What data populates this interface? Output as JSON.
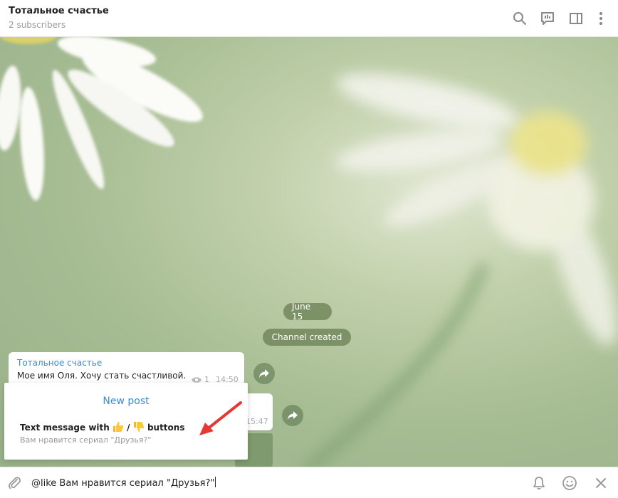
{
  "header": {
    "title": "Тотальное счастье",
    "subtitle": "2 subscribers",
    "icons": [
      "search-icon",
      "discuss-icon",
      "sidebar-toggle-icon",
      "more-vertical-icon"
    ]
  },
  "chat": {
    "date_pill": "June 15",
    "service_pill": "Channel created",
    "messages": [
      {
        "sender": "Тотальное счастье",
        "text": "Мое имя Оля. Хочу стать счастливой.",
        "views": "1",
        "time": "14:50"
      },
      {
        "time": "15:47"
      }
    ]
  },
  "inline_results": {
    "header": "New post",
    "item_title_prefix": "Text message with",
    "item_title_separator": "/",
    "item_title_suffix": "buttons",
    "item_description": "Вам нравится сериал \"Друзья?\""
  },
  "input": {
    "value": "@like Вам нравится сериал \"Друзья?\""
  },
  "colors": {
    "accent": "#3a8bd3",
    "annotation_arrow": "#e53935",
    "pill_bg": "#6c8254"
  }
}
